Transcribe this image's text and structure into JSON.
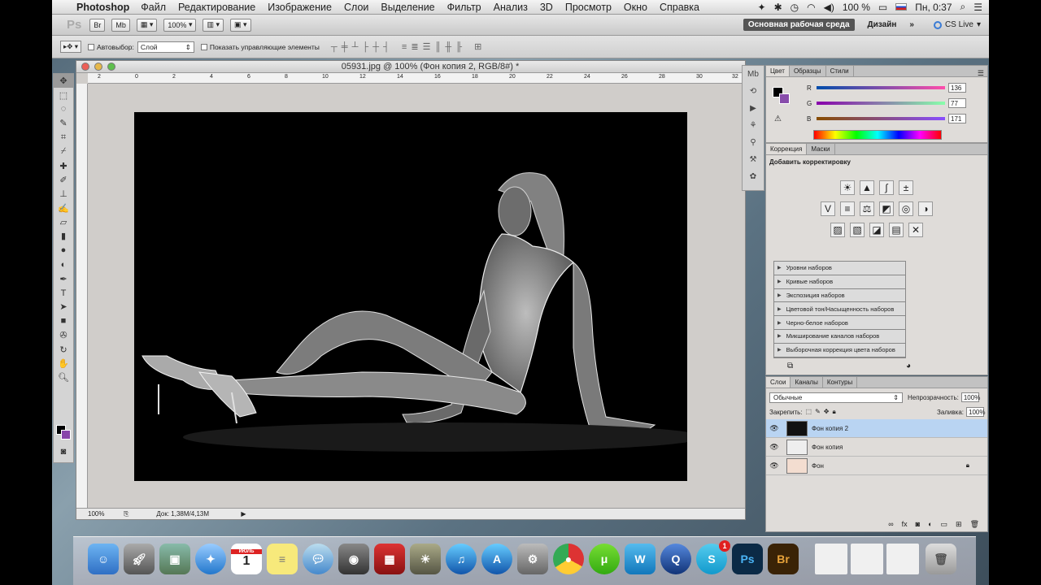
{
  "menubar": {
    "app": "Photoshop",
    "menus": [
      "Файл",
      "Редактирование",
      "Изображение",
      "Слои",
      "Выделение",
      "Фильтр",
      "Анализ",
      "3D",
      "Просмотр",
      "Окно",
      "Справка"
    ],
    "battery": "100 %",
    "clock": "Пн, 0:37"
  },
  "appbar": {
    "logo": "Ps",
    "bridge": "Br",
    "minibridge": "Mb",
    "zoom": "100%",
    "workspace_active": "Основная рабочая среда",
    "workspace_design": "Дизайн",
    "more": "»",
    "cslive": "CS Live"
  },
  "options": {
    "autoselect": "Автовыбор:",
    "autoselect_value": "Слой",
    "show_controls": "Показать управляющие элементы"
  },
  "document": {
    "title": "05931.jpg @ 100% (Фон копия 2, RGB/8#) *",
    "ruler_ticks": [
      "2",
      "0",
      "2",
      "4",
      "6",
      "8",
      "10",
      "12",
      "14",
      "16",
      "18",
      "20",
      "22",
      "24",
      "26",
      "28",
      "30",
      "32"
    ],
    "status_zoom": "100%",
    "status_doc": "Док: 1,38M/4,13M"
  },
  "color_panel": {
    "tabs": [
      "Цвет",
      "Образцы",
      "Стили"
    ],
    "channels": [
      {
        "label": "R",
        "value": "136"
      },
      {
        "label": "G",
        "value": "77"
      },
      {
        "label": "B",
        "value": "171"
      }
    ],
    "fg_color": "#000000",
    "bg_color": "#884dab"
  },
  "adjustments_panel": {
    "tabs": [
      "Коррекция",
      "Маски"
    ],
    "title": "Добавить корректировку",
    "presets": [
      "Уровни наборов",
      "Кривые наборов",
      "Экспозиция наборов",
      "Цветовой тон/Насыщенность наборов",
      "Черно-белое наборов",
      "Микширование каналов наборов",
      "Выборочная коррекция цвета наборов"
    ]
  },
  "layers_panel": {
    "tabs": [
      "Слои",
      "Каналы",
      "Контуры"
    ],
    "blend_mode": "Обычные",
    "opacity_label": "Непрозрачность:",
    "opacity": "100%",
    "lock_label": "Закрепить:",
    "fill_label": "Заливка:",
    "fill": "100%",
    "layers": [
      {
        "name": "Фон копия 2",
        "selected": true
      },
      {
        "name": "Фон копия",
        "selected": false
      },
      {
        "name": "Фон",
        "selected": false
      }
    ]
  },
  "dock": {
    "items": [
      "finder-icon",
      "rocket-icon",
      "preview-icon",
      "safari-icon",
      "calendar-icon",
      "stickies-icon",
      "messages-icon",
      "facetime-icon",
      "photobooth-icon",
      "iphoto-icon",
      "itunes-icon",
      "appstore-icon",
      "sysprefs-icon",
      "chrome-icon",
      "utorrent-icon",
      "word-icon",
      "quicktime-icon",
      "skype-icon",
      "photoshop-icon",
      "bridge-icon",
      "trash-icon"
    ],
    "calendar_month": "ИЮЛЬ",
    "calendar_day": "1",
    "skype_badge": "1",
    "ps_label": "Ps",
    "br_label": "Br"
  }
}
